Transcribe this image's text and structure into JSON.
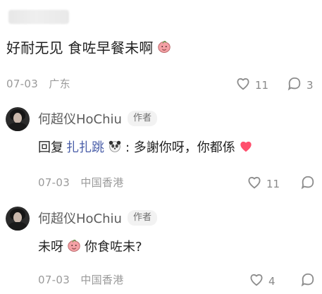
{
  "comment": {
    "text": "好耐无见 食咗早餐未啊",
    "date": "07-03",
    "location": "广东",
    "likes": "11",
    "replies_count": "3"
  },
  "replies": [
    {
      "author": "何超仪HoChiu",
      "badge": "作者",
      "prefix": "回复",
      "mention": "扎扎跳",
      "text": ": 多謝你呀，你都係",
      "date": "07-03",
      "location": "中国香港",
      "likes": "11"
    },
    {
      "author": "何超仪HoChiu",
      "badge": "作者",
      "text_before": "未呀",
      "text_after": "你食咗未?",
      "date": "07-03",
      "location": "中国香港",
      "likes": "4"
    }
  ],
  "icons": {
    "heart_outline": "heart-outline-icon",
    "comment_bubble": "comment-bubble-icon",
    "peach_emoji": "peach-emoji-icon",
    "panda_emoji": "panda-emoji-icon",
    "heart_red": "heart-red-icon"
  },
  "colors": {
    "mention": "#4a5ea8",
    "meta": "#9a9a9a",
    "badge_bg": "#f2f2f2",
    "heart_red": "#ff4f6d"
  }
}
